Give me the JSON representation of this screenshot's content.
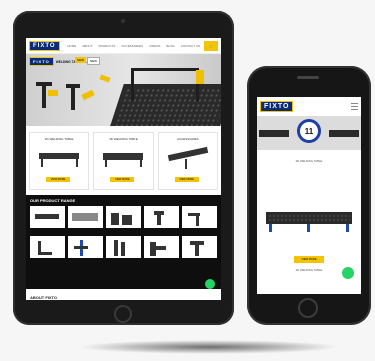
{
  "brand": "FIXTO",
  "colors": {
    "brand_blue": "#0b2a78",
    "accent_yellow": "#f5c400",
    "dark": "#0e0e0e",
    "whatsapp": "#25d366"
  },
  "tablet": {
    "nav": {
      "links": [
        "HOME",
        "ABOUT",
        "PRODUCTS",
        "ACCESSORIES",
        "VIDEOS",
        "BLOG",
        "CONTACT US"
      ],
      "cart_icon": "cart-icon"
    },
    "hero": {
      "title": "WELDING TABLE CLAMPS",
      "new_label": "NEW",
      "tag": "NEW"
    },
    "products": [
      {
        "title": "2D WELDING TABLE",
        "button": "VIEW MORE"
      },
      {
        "title": "3D WELDING TABLE",
        "button": "VIEW MORE"
      },
      {
        "title": "ACCESSORIES",
        "button": "VIEW MORE"
      }
    ],
    "range": {
      "title": "OUR PRODUCT RANGE"
    },
    "about": {
      "title": "ABOUT FIXTO"
    }
  },
  "phone": {
    "badge": "11",
    "caption_top": "2D WELDING TABLE",
    "button": "VIEW MORE",
    "caption_bottom": "2D WELDING TABLE"
  }
}
